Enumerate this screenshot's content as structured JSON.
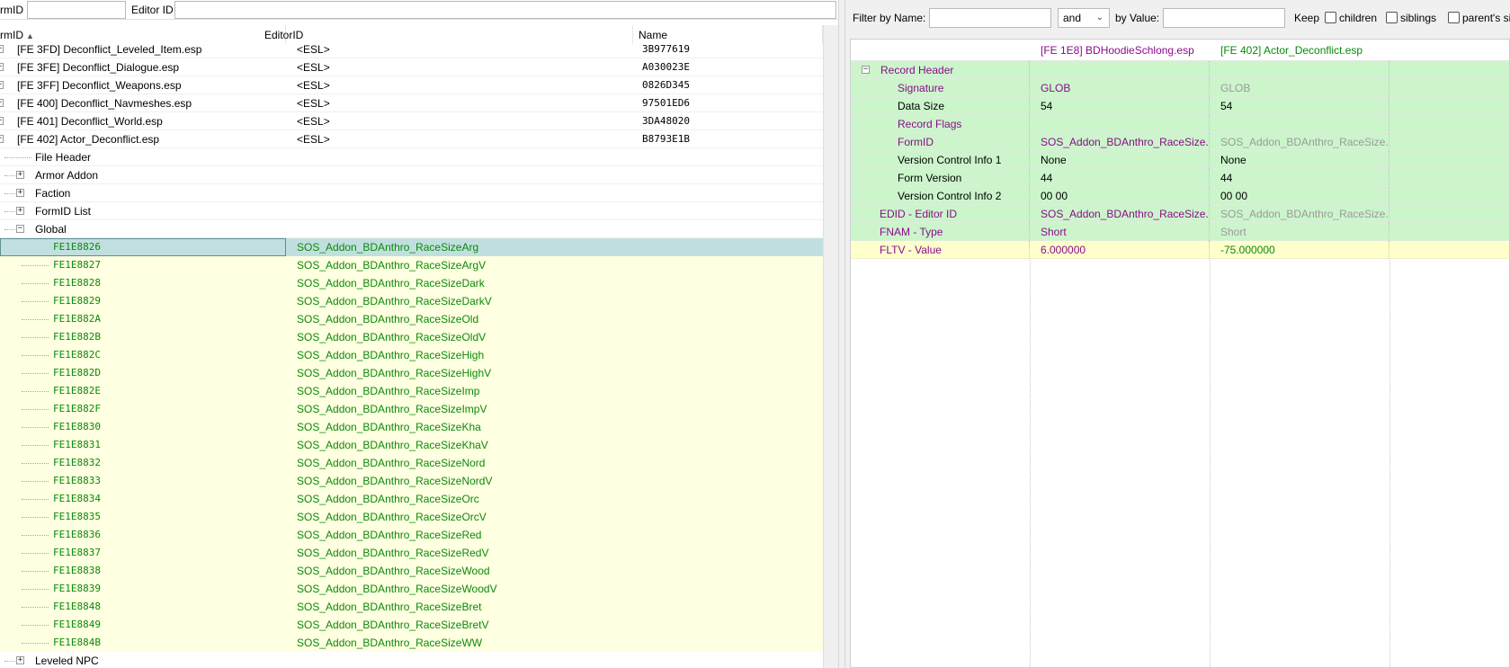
{
  "left_filter": {
    "form_id_label": "rmID",
    "form_id_value": "",
    "editor_id_label": "Editor ID",
    "editor_id_value": ""
  },
  "left_header": {
    "col_formid": "rmID",
    "col_editorid": "EditorID",
    "col_name": "Name"
  },
  "plugins": [
    {
      "label": "[FE 3FD] Deconflict_Leveled_Item.esp",
      "edid": "<ESL>",
      "name": "3B977619"
    },
    {
      "label": "[FE 3FE] Deconflict_Dialogue.esp",
      "edid": "<ESL>",
      "name": "A030023E"
    },
    {
      "label": "[FE 3FF] Deconflict_Weapons.esp",
      "edid": "<ESL>",
      "name": "0826D345"
    },
    {
      "label": "[FE 400] Deconflict_Navmeshes.esp",
      "edid": "<ESL>",
      "name": "97501ED6"
    },
    {
      "label": "[FE 401] Deconflict_World.esp",
      "edid": "<ESL>",
      "name": "3DA48020"
    },
    {
      "label": "[FE 402] Actor_Deconflict.esp",
      "edid": "<ESL>",
      "name": "B8793E1B"
    }
  ],
  "groups": [
    {
      "label": "File Header"
    },
    {
      "label": "Armor Addon"
    },
    {
      "label": "Faction"
    },
    {
      "label": "FormID List"
    },
    {
      "label": "Global"
    }
  ],
  "records": [
    {
      "formid": "FE1E8826",
      "edid": "SOS_Addon_BDAnthro_RaceSizeArg"
    },
    {
      "formid": "FE1E8827",
      "edid": "SOS_Addon_BDAnthro_RaceSizeArgV"
    },
    {
      "formid": "FE1E8828",
      "edid": "SOS_Addon_BDAnthro_RaceSizeDark"
    },
    {
      "formid": "FE1E8829",
      "edid": "SOS_Addon_BDAnthro_RaceSizeDarkV"
    },
    {
      "formid": "FE1E882A",
      "edid": "SOS_Addon_BDAnthro_RaceSizeOld"
    },
    {
      "formid": "FE1E882B",
      "edid": "SOS_Addon_BDAnthro_RaceSizeOldV"
    },
    {
      "formid": "FE1E882C",
      "edid": "SOS_Addon_BDAnthro_RaceSizeHigh"
    },
    {
      "formid": "FE1E882D",
      "edid": "SOS_Addon_BDAnthro_RaceSizeHighV"
    },
    {
      "formid": "FE1E882E",
      "edid": "SOS_Addon_BDAnthro_RaceSizeImp"
    },
    {
      "formid": "FE1E882F",
      "edid": "SOS_Addon_BDAnthro_RaceSizeImpV"
    },
    {
      "formid": "FE1E8830",
      "edid": "SOS_Addon_BDAnthro_RaceSizeKha"
    },
    {
      "formid": "FE1E8831",
      "edid": "SOS_Addon_BDAnthro_RaceSizeKhaV"
    },
    {
      "formid": "FE1E8832",
      "edid": "SOS_Addon_BDAnthro_RaceSizeNord"
    },
    {
      "formid": "FE1E8833",
      "edid": "SOS_Addon_BDAnthro_RaceSizeNordV"
    },
    {
      "formid": "FE1E8834",
      "edid": "SOS_Addon_BDAnthro_RaceSizeOrc"
    },
    {
      "formid": "FE1E8835",
      "edid": "SOS_Addon_BDAnthro_RaceSizeOrcV"
    },
    {
      "formid": "FE1E8836",
      "edid": "SOS_Addon_BDAnthro_RaceSizeRed"
    },
    {
      "formid": "FE1E8837",
      "edid": "SOS_Addon_BDAnthro_RaceSizeRedV"
    },
    {
      "formid": "FE1E8838",
      "edid": "SOS_Addon_BDAnthro_RaceSizeWood"
    },
    {
      "formid": "FE1E8839",
      "edid": "SOS_Addon_BDAnthro_RaceSizeWoodV"
    },
    {
      "formid": "FE1E8848",
      "edid": "SOS_Addon_BDAnthro_RaceSizeBret"
    },
    {
      "formid": "FE1E8849",
      "edid": "SOS_Addon_BDAnthro_RaceSizeBretV"
    },
    {
      "formid": "FE1E884B",
      "edid": "SOS_Addon_BDAnthro_RaceSizeWW"
    }
  ],
  "trailing_group": {
    "label": "Leveled NPC"
  },
  "right_toolbar": {
    "filter_name_label": "Filter by Name:",
    "filter_name_value": "",
    "logic_value": "and",
    "by_value_label": "by Value:",
    "by_value_value": "",
    "keep_label": "Keep",
    "children_label": "children",
    "siblings_label": "siblings",
    "parents_siblings_label": "parent's sib"
  },
  "record_view": {
    "col1_header": "",
    "col2_header": "[FE 1E8] BDHoodieSchlong.esp",
    "col3_header": "[FE 402] Actor_Deconflict.esp",
    "rows": [
      {
        "label": "Record Header",
        "v1": "",
        "v2": ""
      },
      {
        "label": "Signature",
        "v1": "GLOB",
        "v2": "GLOB"
      },
      {
        "label": "Data Size",
        "v1": "54",
        "v2": "54"
      },
      {
        "label": "Record Flags",
        "v1": "",
        "v2": ""
      },
      {
        "label": "FormID",
        "v1": "SOS_Addon_BDAnthro_RaceSize...",
        "v2": "SOS_Addon_BDAnthro_RaceSize..."
      },
      {
        "label": "Version Control Info 1",
        "v1": "None",
        "v2": "None"
      },
      {
        "label": "Form Version",
        "v1": "44",
        "v2": "44"
      },
      {
        "label": "Version Control Info 2",
        "v1": "00 00",
        "v2": "00 00"
      },
      {
        "label": "EDID - Editor ID",
        "v1": "SOS_Addon_BDAnthro_RaceSize...",
        "v2": "SOS_Addon_BDAnthro_RaceSize..."
      },
      {
        "label": "FNAM - Type",
        "v1": "Short",
        "v2": "Short"
      },
      {
        "label": "FLTV - Value",
        "v1": "6.000000",
        "v2": "-75.000000"
      }
    ]
  },
  "colors": {
    "selected_row": "#c1dfdf",
    "conflict_yellow": "#ffffe1",
    "match_green": "#ccf5cc",
    "record_text_green": "#0a8a0a",
    "header_purple": "#8b0c8b"
  }
}
